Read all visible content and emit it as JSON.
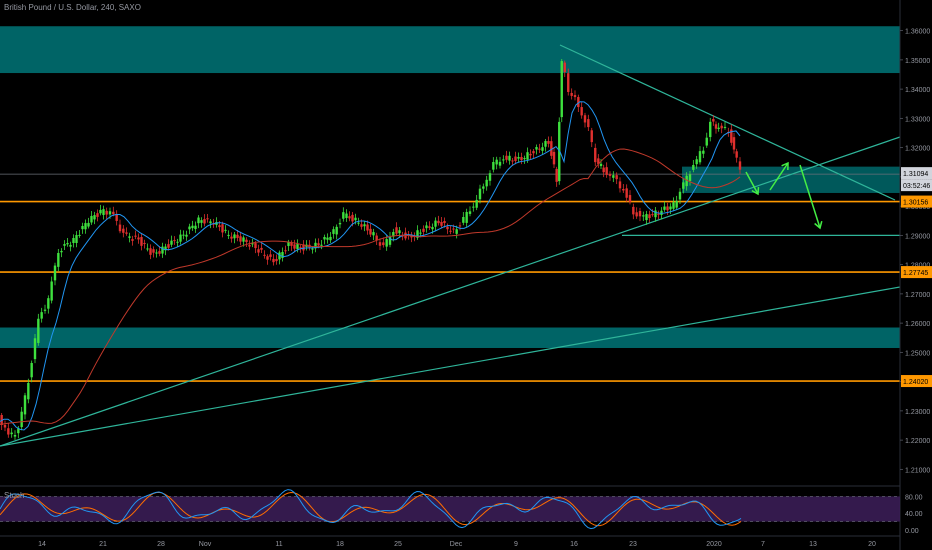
{
  "header": {
    "title": "British Pound / U.S. Dollar, 240, SAXO"
  },
  "oscillator": {
    "label": "Stoch",
    "levels": [
      "80.00",
      "40.00",
      "0.00"
    ]
  },
  "price_badges": {
    "current": "1.31094",
    "countdown": "03:52:46",
    "support_1": "1.30156",
    "support_2": "1.27745",
    "support_3": "1.24020"
  },
  "colors": {
    "background": "#000000",
    "zone": "#00696b",
    "horizontal_level": "#ff9800",
    "trendline": "#2fb59a",
    "candle_up": "#3ee03e",
    "candle_down": "#e0302e",
    "ma_fast": "#2196f3",
    "ma_slow": "#c0392b",
    "arrow": "#44ee44",
    "stoch_k": "#2196f3",
    "stoch_d": "#ff6d00",
    "stoch_band": "#3a1d55"
  },
  "chart_data": {
    "type": "candlestick",
    "symbol": "British Pound / U.S. Dollar",
    "timeframe": "240",
    "source": "SAXO",
    "ylim": [
      1.205,
      1.365
    ],
    "y_ticks": [
      "1.36000",
      "1.35000",
      "1.34000",
      "1.33000",
      "1.32000",
      "1.31000",
      "1.30000",
      "1.29000",
      "1.28000",
      "1.27000",
      "1.26000",
      "1.25000",
      "1.24000",
      "1.23000",
      "1.22000",
      "1.21000"
    ],
    "x_ticks": [
      "14",
      "21",
      "28",
      "Nov",
      "11",
      "18",
      "25",
      "Dec",
      "9",
      "16",
      "23",
      "2020",
      "7",
      "13",
      "20"
    ],
    "zones": [
      {
        "low": 1.3455,
        "high": 1.3615
      },
      {
        "low": 1.2515,
        "high": 1.2585
      },
      {
        "low": 1.3045,
        "high": 1.3135
      }
    ],
    "levels": [
      1.30156,
      1.27745,
      1.2402
    ],
    "support_line": 1.29,
    "price_path": [
      [
        10.02,
        1.2215
      ],
      [
        10.06,
        1.226
      ],
      [
        10.1,
        1.248
      ],
      [
        10.12,
        1.258
      ],
      [
        10.14,
        1.264
      ],
      [
        10.17,
        1.28
      ],
      [
        10.21,
        1.288
      ],
      [
        10.24,
        1.294
      ],
      [
        10.26,
        1.288
      ],
      [
        10.29,
        1.285
      ],
      [
        11.02,
        1.292
      ],
      [
        11.05,
        1.288
      ],
      [
        11.08,
        1.283
      ],
      [
        11.11,
        1.284
      ],
      [
        11.14,
        1.286
      ],
      [
        11.18,
        1.288
      ],
      [
        11.21,
        1.286
      ],
      [
        11.25,
        1.29
      ],
      [
        11.28,
        1.288
      ],
      [
        12.02,
        1.291
      ],
      [
        12.05,
        1.31
      ],
      [
        12.09,
        1.317
      ],
      [
        12.12,
        1.315
      ],
      [
        12.13,
        1.35
      ],
      [
        12.16,
        1.335
      ],
      [
        12.18,
        1.312
      ],
      [
        12.2,
        1.308
      ],
      [
        12.23,
        1.293
      ],
      [
        12.25,
        1.296
      ],
      [
        12.27,
        1.301
      ],
      [
        12.3,
        1.31
      ],
      [
        12.31,
        1.325
      ],
      [
        1.02,
        1.32
      ],
      [
        1.03,
        1.3115
      ]
    ],
    "projection": [
      [
        1.03,
        1.3115
      ],
      [
        1.04,
        1.304
      ],
      [
        1.06,
        1.312
      ],
      [
        1.08,
        1.307
      ],
      [
        1.1,
        1.291
      ]
    ],
    "stochastic": {
      "upper": 80,
      "lower": 20
    }
  }
}
